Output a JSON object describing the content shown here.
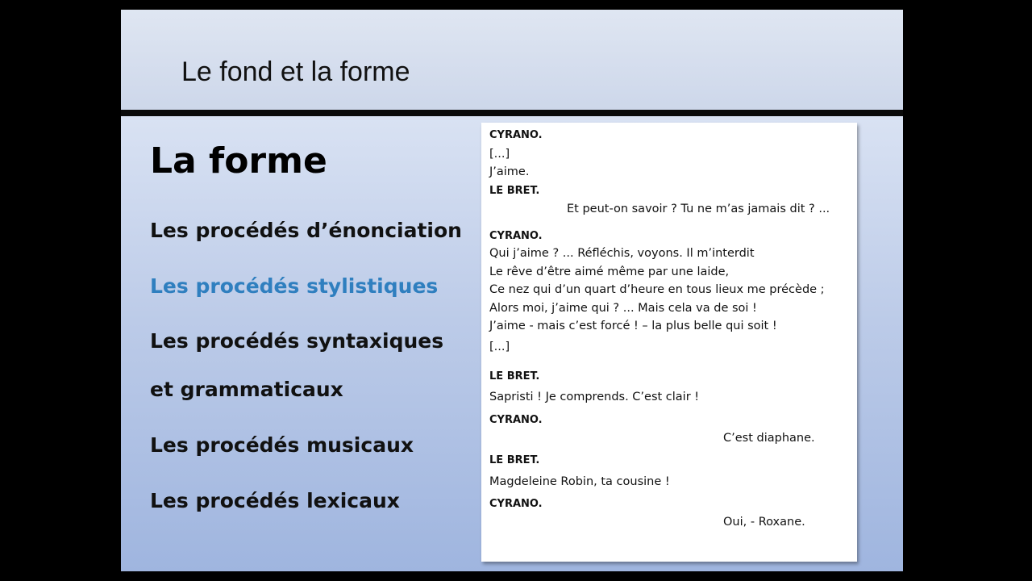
{
  "slide": {
    "title": "Le fond et la forme",
    "heading": "La forme",
    "items": [
      "Les procédés d’énonciation",
      "Les procédés stylistiques",
      "Les procédés syntaxiques",
      "et grammaticaux",
      "Les procédés musicaux",
      "Les procédés lexicaux"
    ],
    "active_item_color": "#2f7fbf"
  },
  "excerpt": {
    "lines": [
      "CYRANO.",
      "[...]",
      "J’aime.",
      "LE BRET.",
      "Et peut-on savoir ? Tu ne m’as jamais dit ? ...",
      "CYRANO.",
      "Qui j’aime ? ... Réfléchis, voyons. Il m’interdit",
      "Le rêve d’être aimé même par une laide,",
      "Ce nez qui d’un quart d’heure en tous lieux me précède ;",
      "Alors moi, j’aime qui ? ... Mais cela va de soi !",
      "J’aime - mais c’est forcé ! – la plus belle qui soit !",
      "[...]",
      "LE BRET.",
      "Sapristi ! Je comprends. C’est clair !",
      "CYRANO.",
      "C’est diaphane.",
      "LE BRET.",
      "Magdeleine Robin, ta cousine !",
      "CYRANO.",
      "Oui, - Roxane."
    ]
  }
}
